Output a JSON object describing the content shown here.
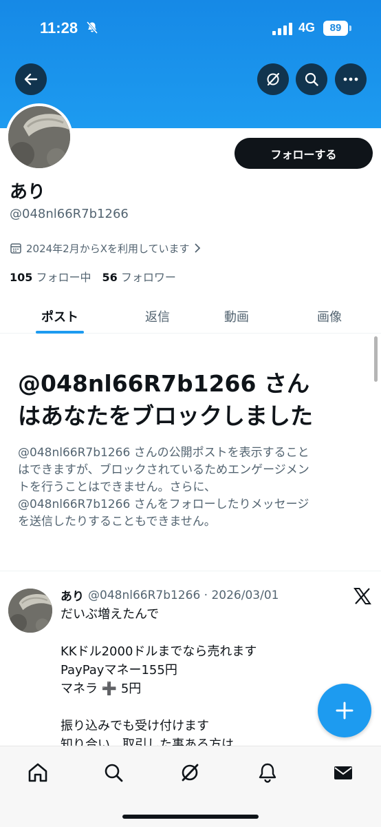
{
  "status_bar": {
    "time": "11:28",
    "network": "4G",
    "battery": "89"
  },
  "profile": {
    "display_name": "あり",
    "handle": "@048nl66R7b1266",
    "follow_button": "フォローする",
    "joined": "2024年2月からXを利用しています",
    "following_count": "105",
    "following_label": "フォロー中",
    "followers_count": "56",
    "followers_label": "フォロワー"
  },
  "tabs": [
    {
      "label": "ポスト",
      "active": true
    },
    {
      "label": "返信",
      "active": false
    },
    {
      "label": "動画",
      "active": false
    },
    {
      "label": "画像",
      "active": false
    }
  ],
  "blocked": {
    "title_line1": "@048nl66R7b1266 さん",
    "title_line2": "はあなたをブロックしました",
    "desc_lines": [
      "@048nl66R7b1266 さんの公開ポストを表示すること",
      "はできますが、ブロックされているためエンゲージメン",
      "トを行うことはできません。さらに、",
      "@048nl66R7b1266 さんをフォローしたりメッセージ",
      "を送信したりすることもできません。"
    ]
  },
  "post": {
    "name": "あり",
    "handle_date": "@048nl66R7b1266 · 2026/03/01",
    "lines": [
      "だいぶ増えたんで",
      "",
      "KKドル2000ドルまでなら売れます",
      "PayPayマネー155円",
      "マネラ ➕ 5円",
      "",
      "振り込みでも受け付けます",
      "知り合い、取引した事ある方は"
    ]
  },
  "colors": {
    "accent": "#1d9bf0",
    "text": "#0f1419",
    "secondary": "#536471"
  }
}
